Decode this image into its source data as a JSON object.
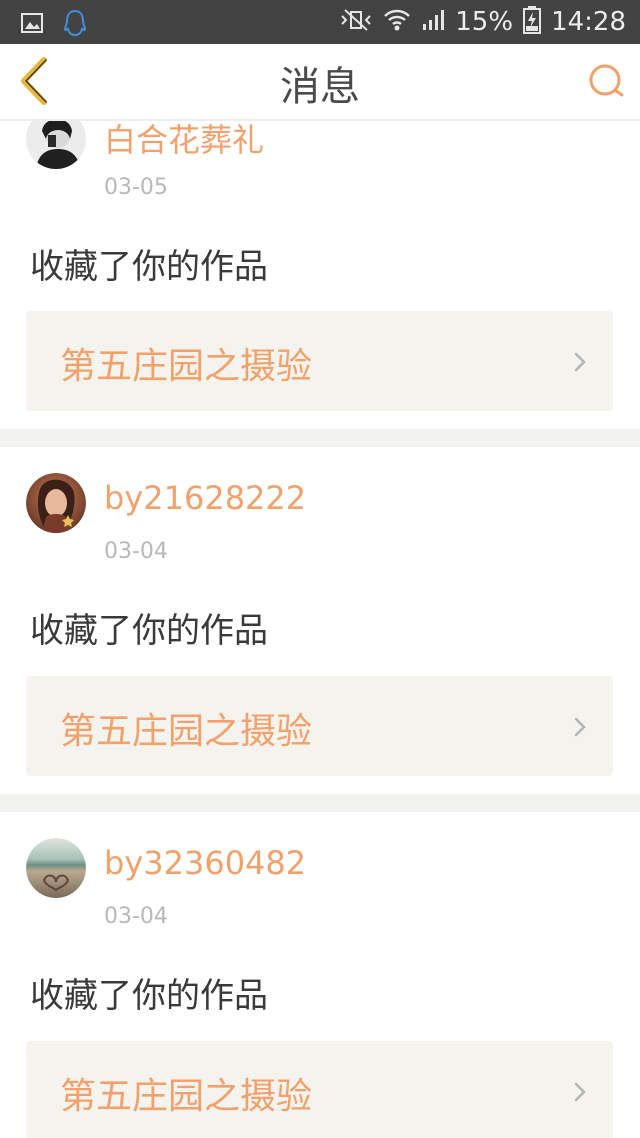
{
  "status_bar": {
    "battery_percent": "15%",
    "time": "14:28",
    "icons": [
      "image-notification-icon",
      "qq-icon",
      "mute-vibrate-icon",
      "wifi-icon",
      "signal-icon",
      "battery-charging-icon"
    ]
  },
  "header": {
    "title": "消息",
    "back_icon": "chevron-left-icon",
    "search_icon": "search-icon"
  },
  "messages": [
    {
      "username": "白合花葬礼",
      "date": "03-05",
      "action": "收藏了你的作品",
      "work_title": "第五庄园之摄验",
      "avatar": "avatar-portrait-dark"
    },
    {
      "username": "by21628222",
      "date": "03-04",
      "action": "收藏了你的作品",
      "work_title": "第五庄园之摄验",
      "avatar": "avatar-portrait-girl"
    },
    {
      "username": "by32360482",
      "date": "03-04",
      "action": "收藏了你的作品",
      "work_title": "第五庄园之摄验",
      "avatar": "avatar-beach"
    }
  ],
  "colors": {
    "accent": "#f3a06b",
    "back_arrow": "#e8b83a",
    "status_bar_bg": "#434343",
    "card_bg": "#f4f3ee",
    "divider_bg": "#f2f2f0"
  }
}
